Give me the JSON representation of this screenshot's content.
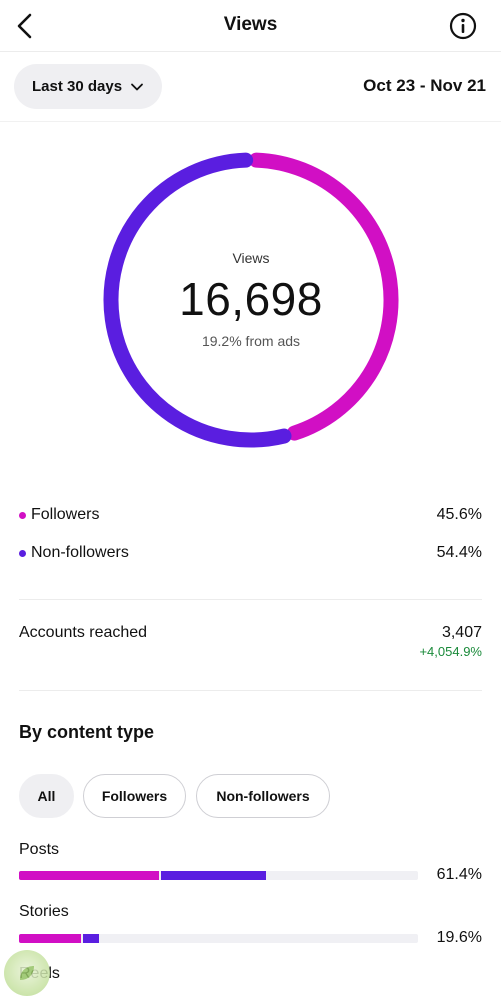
{
  "header": {
    "title": "Views",
    "back_icon": "back-arrow-icon",
    "info_icon": "info-icon"
  },
  "range": {
    "selector_label": "Last 30 days",
    "date_range": "Oct 23 - Nov 21"
  },
  "summary": {
    "label": "Views",
    "total": "16,698",
    "ads_note": "19.2% from ads"
  },
  "colors": {
    "followers": "#d10fc4",
    "non_followers": "#5a1ee0",
    "positive": "#1a8a3a"
  },
  "breakdown": [
    {
      "label": "Followers",
      "percent": "45.6%",
      "value": 45.6
    },
    {
      "label": "Non-followers",
      "percent": "54.4%",
      "value": 54.4
    }
  ],
  "accounts_reached": {
    "label": "Accounts reached",
    "value": "3,407",
    "change": "+4,054.9%"
  },
  "content_type": {
    "title": "By content type",
    "filters": [
      "All",
      "Followers",
      "Non-followers"
    ],
    "active_filter": "All",
    "rows": [
      {
        "label": "Posts",
        "percent": "61.4%",
        "followers_share": 35.0,
        "non_followers_share": 26.4
      },
      {
        "label": "Stories",
        "percent": "19.6%",
        "followers_share": 15.5,
        "non_followers_share": 4.1
      },
      {
        "label": "Reels"
      }
    ]
  }
}
